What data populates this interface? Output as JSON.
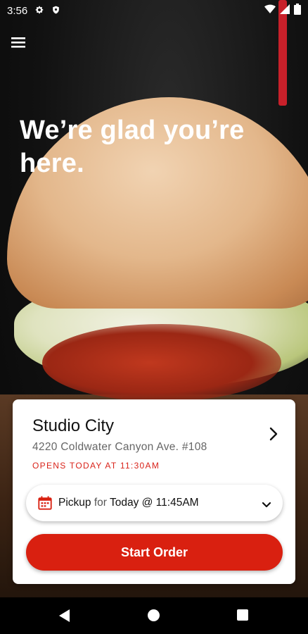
{
  "status_bar": {
    "time": "3:56",
    "left_icons": [
      "gear-icon",
      "shield-icon"
    ],
    "right_icons": [
      "wifi-icon",
      "signal-icon",
      "battery-icon"
    ]
  },
  "header": {
    "menu_icon": "hamburger-menu-icon"
  },
  "hero": {
    "headline": "We’re glad you’re here."
  },
  "store_card": {
    "name": "Studio City",
    "address": "4220 Coldwater Canyon Ave. #108",
    "hours": "OPENS TODAY AT 11:30AM",
    "pickup": {
      "mode": "Pickup",
      "connector": "for",
      "time": "Today @ 11:45AM"
    },
    "start_order_label": "Start Order"
  },
  "colors": {
    "accent": "#d92010",
    "hours_text": "#d9231a"
  }
}
